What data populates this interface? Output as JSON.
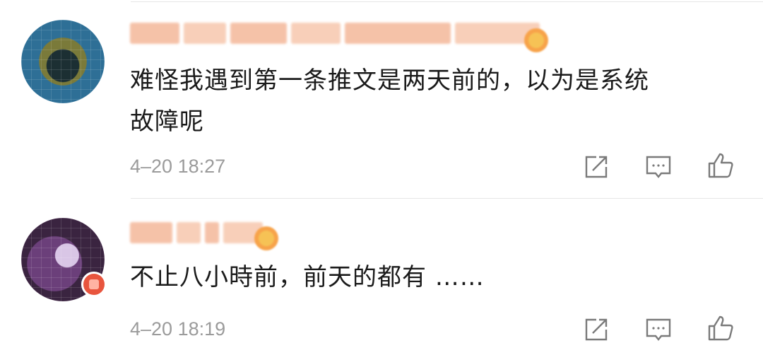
{
  "comments": [
    {
      "text_line1": "难怪我遇到第一条推文是两天前的，以为是系统",
      "text_line2": "故障呢",
      "time": "4–20 18:27",
      "avatar": "blurred-avatar",
      "username_blurred": true
    },
    {
      "text_line1": "不止八小時前，前天的都有 ……",
      "time": "4–20 18:19",
      "avatar": "blurred-avatar",
      "username_blurred": true
    }
  ],
  "actions": {
    "share_icon": "share-icon",
    "comment_icon": "comment-icon",
    "like_icon": "like-icon"
  },
  "colors": {
    "text": "#1a1a1a",
    "meta": "#9b9b9b",
    "icon": "#7a7a7a",
    "blurred_name": "#f4b89a"
  }
}
